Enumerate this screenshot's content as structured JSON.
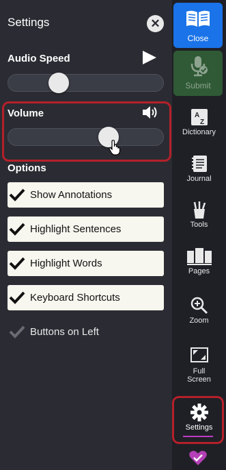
{
  "panel": {
    "title": "Settings",
    "audio_speed_label": "Audio Speed",
    "volume_label": "Volume",
    "options_label": "Options",
    "audio_speed_level": 0.3,
    "volume_level": 0.67
  },
  "options": [
    {
      "label": "Show Annotations",
      "checked": true
    },
    {
      "label": "Highlight Sentences",
      "checked": true
    },
    {
      "label": "Highlight Words",
      "checked": true
    },
    {
      "label": "Keyboard Shortcuts",
      "checked": true
    },
    {
      "label": "Buttons on Left",
      "checked": false
    }
  ],
  "sidebar": {
    "close": "Close",
    "submit": "Submit",
    "dictionary": "Dictionary",
    "journal": "Journal",
    "tools": "Tools",
    "pages": "Pages",
    "zoom": "Zoom",
    "full_screen_line1": "Full",
    "full_screen_line2": "Screen",
    "settings": "Settings"
  },
  "colors": {
    "close_bg": "#1a73e8",
    "submit_bg": "#2f5a35",
    "highlight_border": "#b5202a",
    "settings_underline": "#c03cc8",
    "heart_check": "#b43fb6"
  }
}
